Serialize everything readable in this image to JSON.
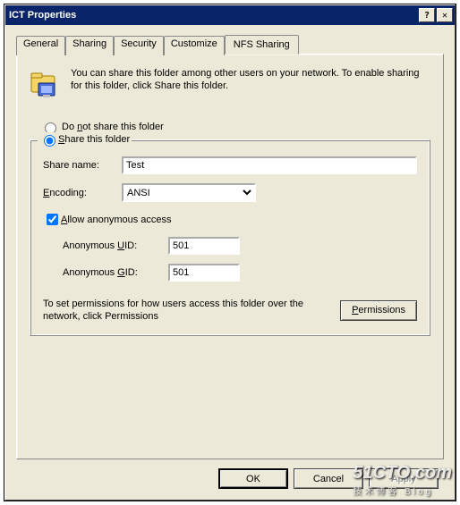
{
  "title": "ICT Properties",
  "tabs": [
    "General",
    "Sharing",
    "Security",
    "Customize",
    "NFS Sharing"
  ],
  "active_tab": "NFS Sharing",
  "intro": "You can share this folder among other users on your network. To enable sharing for this folder, click Share this folder.",
  "radio": {
    "no_share": "Do not share this folder",
    "share": "Share this folder",
    "selected": "share"
  },
  "fields": {
    "share_name_label": "Share name:",
    "share_name_value": "Test",
    "encoding_label": "Encoding:",
    "encoding_value": "ANSI",
    "allow_anon_label": "Allow anonymous access",
    "allow_anon_checked": true,
    "anon_uid_label": "Anonymous UID:",
    "anon_uid_value": "501",
    "anon_gid_label": "Anonymous GID:",
    "anon_gid_value": "501"
  },
  "perm_text": "To set permissions for how users access this folder over the network, click Permissions",
  "buttons": {
    "permissions": "Permissions",
    "ok": "OK",
    "cancel": "Cancel",
    "apply": "Apply"
  },
  "watermark": {
    "main": "51CTO.com",
    "sub": "技术博客  Blog"
  }
}
